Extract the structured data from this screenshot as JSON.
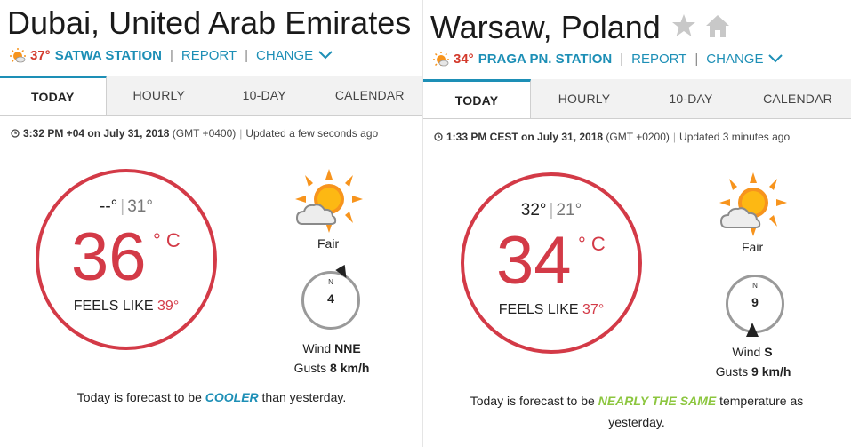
{
  "panels": [
    {
      "city": "Dubai, United Arab Emirates",
      "station_temp": "37°",
      "station_name": "SATWA STATION",
      "report_label": "REPORT",
      "change_label": "CHANGE",
      "tabs": [
        "TODAY",
        "HOURLY",
        "10-DAY",
        "CALENDAR"
      ],
      "updated_time": "3:32 PM +04 on July 31, 2018",
      "updated_tz": "(GMT +0400)",
      "updated_ago": "Updated a few seconds ago",
      "high": "--°",
      "low": "31°",
      "temp": "36",
      "unit": "° C",
      "feels_label": "FEELS LIKE",
      "feels_value": "39°",
      "condition": "Fair",
      "condition_icon": "sun-cloud-icon",
      "wind_speed": "4",
      "compass_n": "N",
      "wind_label": "Wind",
      "wind_dir": "NNE",
      "gusts_label": "Gusts",
      "gusts_value": "8 km/h",
      "summary_pre": "Today is forecast to be ",
      "summary_hl": "COOLER",
      "summary_post": " than yesterday.",
      "summary_color": "#1d8fb6"
    },
    {
      "city": "Warsaw, Poland",
      "station_temp": "34°",
      "station_name": "PRAGA PN. STATION",
      "report_label": "REPORT",
      "change_label": "CHANGE",
      "tabs": [
        "TODAY",
        "HOURLY",
        "10-DAY",
        "CALENDAR"
      ],
      "updated_time": "1:33 PM CEST on July 31, 2018",
      "updated_tz": "(GMT +0200)",
      "updated_ago": "Updated 3 minutes ago",
      "high": "32°",
      "low": "21°",
      "temp": "34",
      "unit": "° C",
      "feels_label": "FEELS LIKE",
      "feels_value": "37°",
      "condition": "Fair",
      "condition_icon": "sun-cloud-icon",
      "wind_speed": "9",
      "compass_n": "N",
      "wind_label": "Wind",
      "wind_dir": "S",
      "gusts_label": "Gusts",
      "gusts_value": "9 km/h",
      "summary_pre": "Today is forecast to be ",
      "summary_hl": "NEARLY THE SAME",
      "summary_post": " temperature as yesterday.",
      "summary_color": "#8cc63f"
    }
  ],
  "colors": {
    "accent": "#1d8fb6",
    "temp_red": "#d33a47",
    "sun_orange": "#f7941d"
  }
}
